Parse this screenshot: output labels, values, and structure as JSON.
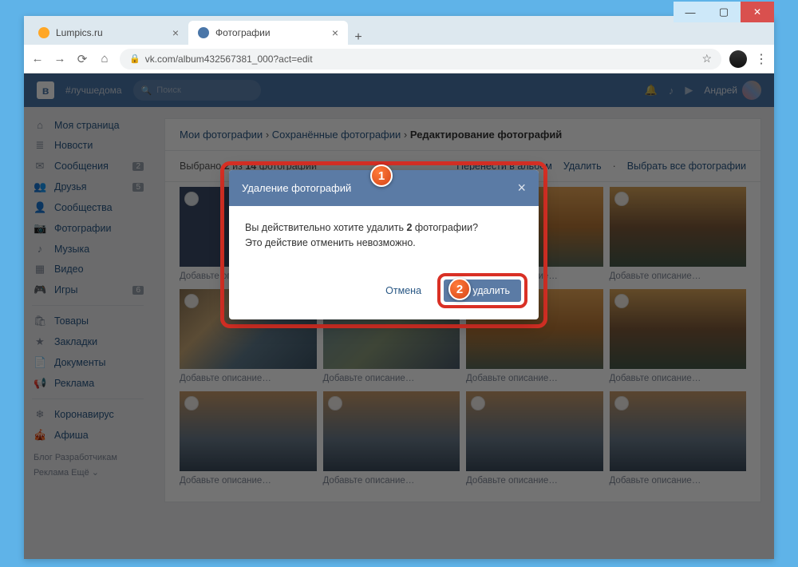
{
  "window": {
    "min": "—",
    "max": "▢",
    "close": "✕"
  },
  "tabs": {
    "first": {
      "title": "Lumpics.ru"
    },
    "second": {
      "title": "Фотографии"
    },
    "close": "×",
    "new": "+"
  },
  "addr": {
    "back": "←",
    "fwd": "→",
    "reload": "⟳",
    "home": "⌂",
    "lock": "🔒",
    "url": "vk.com/album432567381_000?act=edit",
    "star": "☆",
    "menu": "⋮"
  },
  "vk": {
    "logo": "в",
    "hashtag": "#лучшедома",
    "search_ico": "🔍",
    "search": "Поиск",
    "bell": "🔔",
    "music": "♪",
    "play": "▶",
    "user": "Андрей"
  },
  "side": {
    "items": [
      {
        "ico": "⌂",
        "label": "Моя страница"
      },
      {
        "ico": "≣",
        "label": "Новости"
      },
      {
        "ico": "✉",
        "label": "Сообщения",
        "badge": "2"
      },
      {
        "ico": "👥",
        "label": "Друзья",
        "badge": "5"
      },
      {
        "ico": "👤",
        "label": "Сообщества"
      },
      {
        "ico": "📷",
        "label": "Фотографии"
      },
      {
        "ico": "♪",
        "label": "Музыка"
      },
      {
        "ico": "▦",
        "label": "Видео"
      },
      {
        "ico": "🎮",
        "label": "Игры",
        "badge": "6"
      }
    ],
    "items2": [
      {
        "ico": "🛍",
        "label": "Товары"
      },
      {
        "ico": "★",
        "label": "Закладки"
      },
      {
        "ico": "📄",
        "label": "Документы"
      },
      {
        "ico": "📢",
        "label": "Реклама"
      }
    ],
    "items3": [
      {
        "ico": "❄",
        "label": "Коронавирус"
      },
      {
        "ico": "🎪",
        "label": "Афиша"
      }
    ],
    "foot": "Блог  Разработчикам\nРеклама  Ещё ⌄"
  },
  "crumbs": {
    "a": "Мои фотографии",
    "b": "Сохранённые фотографии",
    "c": "Редактирование фотографий",
    "sep": "›"
  },
  "toolbar": {
    "selected_pre": "Выбрано ",
    "selected_n": "2",
    "selected_mid": " из ",
    "selected_total": "14",
    "selected_post": " фотографий",
    "move": "Перенести в альбом",
    "delete": "Удалить",
    "select_all": "Выбрать все фотографии"
  },
  "photo": {
    "caption": "Добавьте описание…"
  },
  "modal": {
    "title": "Удаление фотографий",
    "body_pre": "Вы действительно хотите удалить ",
    "body_n": "2",
    "body_post": " фотографии?",
    "body_line2": "Это действие отменить невозможно.",
    "cancel": "Отмена",
    "confirm": "Да, удалить",
    "close": "×"
  },
  "callouts": {
    "c1": "1",
    "c2": "2"
  }
}
